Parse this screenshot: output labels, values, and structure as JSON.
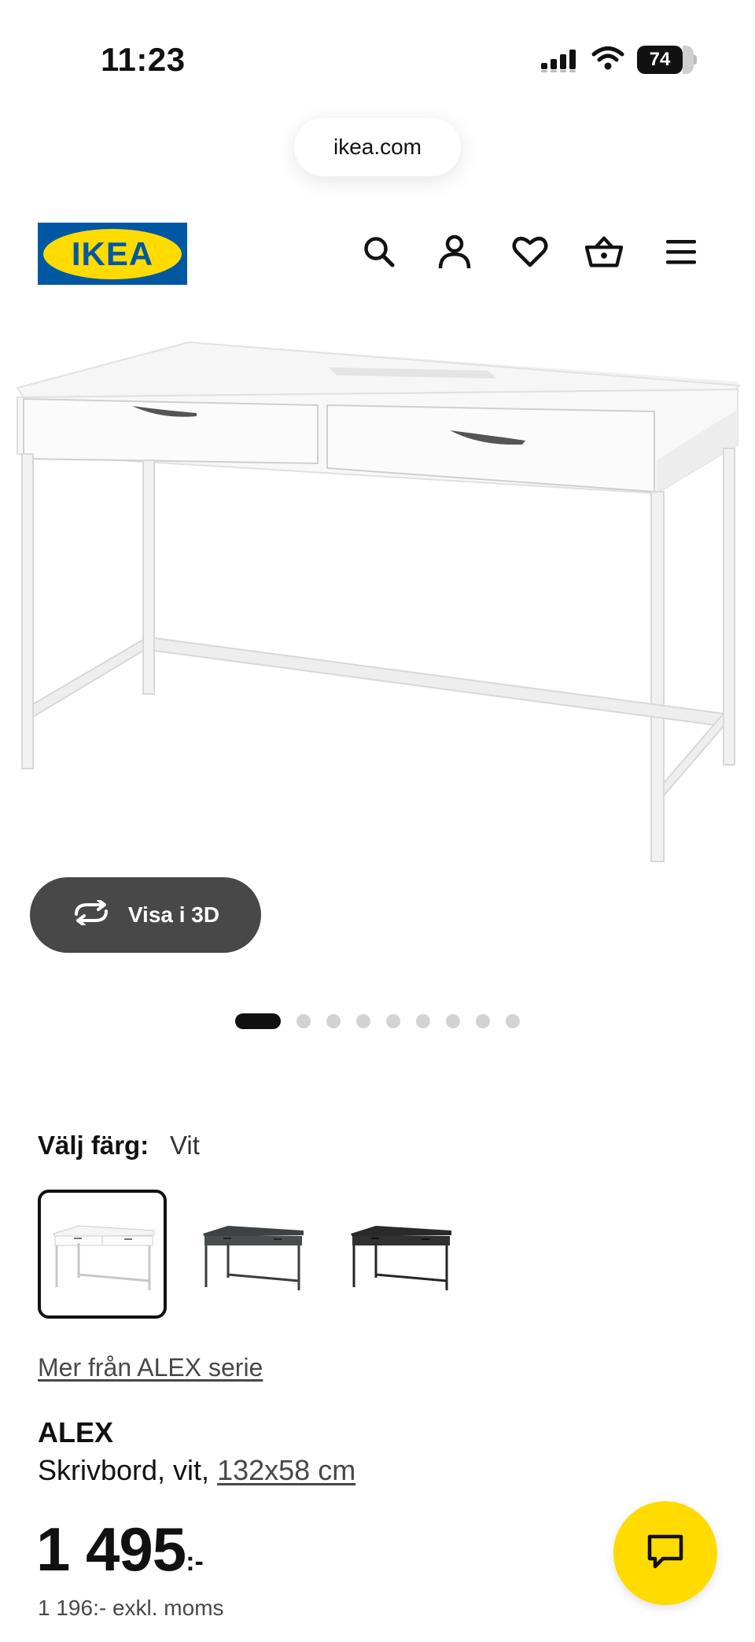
{
  "status_bar": {
    "time": "11:23",
    "battery": "74"
  },
  "browser": {
    "url": "ikea.com"
  },
  "header": {
    "logo_text": "IKEA",
    "icons": [
      "search-icon",
      "account-icon",
      "heart-icon",
      "basket-icon",
      "menu-icon"
    ]
  },
  "gallery": {
    "view_3d_label": "Visa i 3D",
    "slide_count": 9,
    "active_slide": 1
  },
  "color_chooser": {
    "label": "Välj färg:",
    "selected": "Vit",
    "options": [
      "Vit",
      "Grå-turkos",
      "Svartbrun"
    ]
  },
  "series_link": "Mer från ALEX serie",
  "product": {
    "name": "ALEX",
    "description": "Skrivbord, vit,",
    "size": "132x58 cm",
    "price": "1 495",
    "price_suffix": ":-",
    "price_excl_vat": "1 196:- exkl. moms"
  },
  "colors": {
    "brand_blue": "#0058a3",
    "brand_yellow": "#ffdb00",
    "button_dark": "#484848"
  }
}
